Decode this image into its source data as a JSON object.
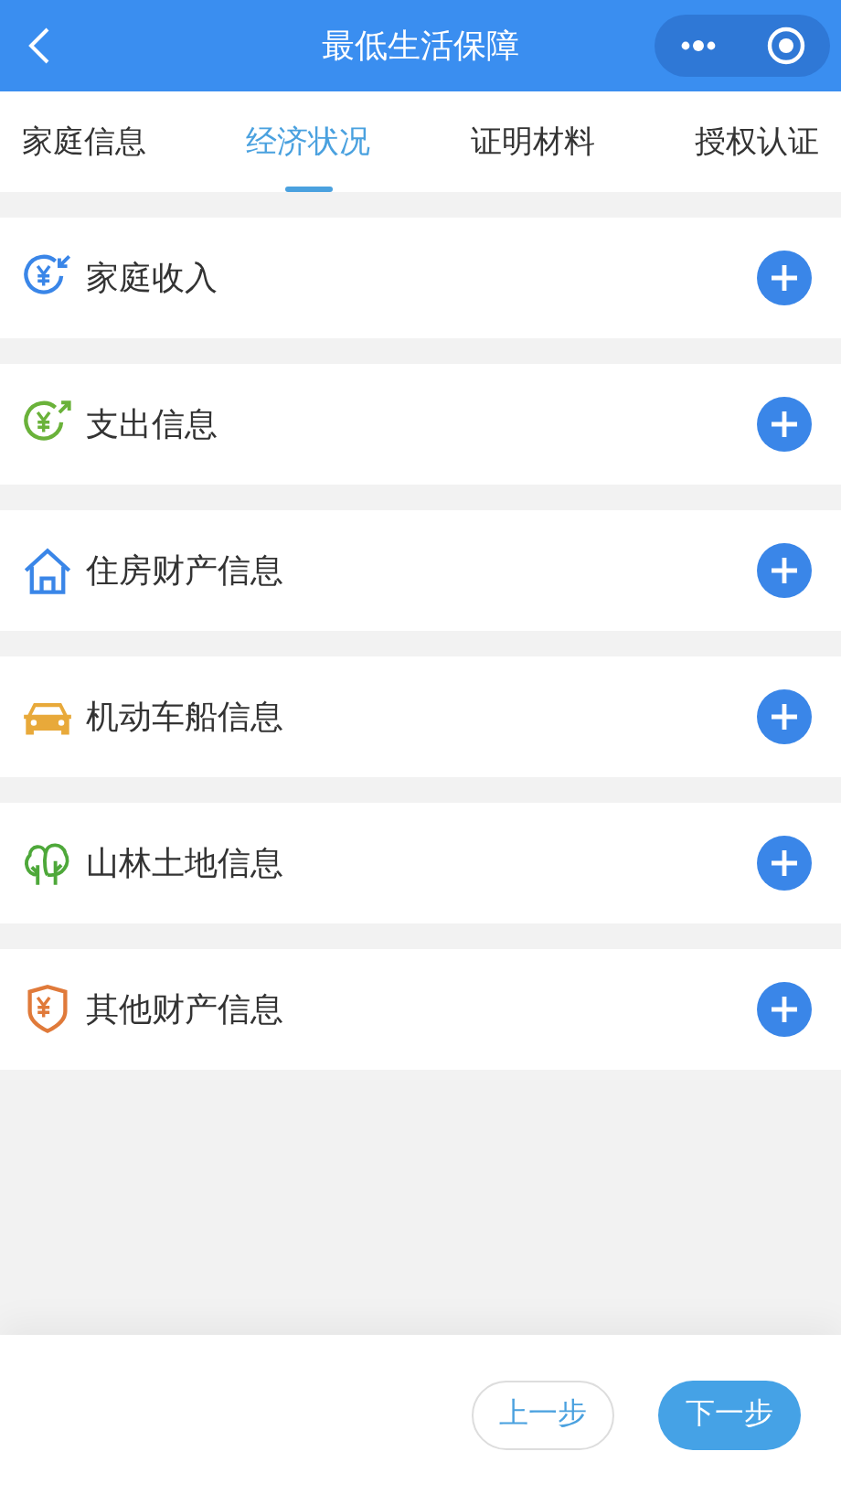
{
  "window": {
    "title": "最低生活保障"
  },
  "tabs": [
    {
      "label": "家庭信息",
      "selected": false
    },
    {
      "label": "经济状况",
      "selected": true
    },
    {
      "label": "证明材料",
      "selected": false
    },
    {
      "label": "授权认证",
      "selected": false
    }
  ],
  "sections": [
    {
      "kind": "income",
      "label": "家庭收入"
    },
    {
      "kind": "expense",
      "label": "支出信息"
    },
    {
      "kind": "house",
      "label": "住房财产信息"
    },
    {
      "kind": "car",
      "label": "机动车船信息"
    },
    {
      "kind": "tree",
      "label": "山林土地信息"
    },
    {
      "kind": "shield",
      "label": "其他财产信息"
    }
  ],
  "buttons": [
    {
      "kind": "secondary",
      "label": "上一步"
    },
    {
      "kind": "primary",
      "label": "下一步"
    }
  ]
}
